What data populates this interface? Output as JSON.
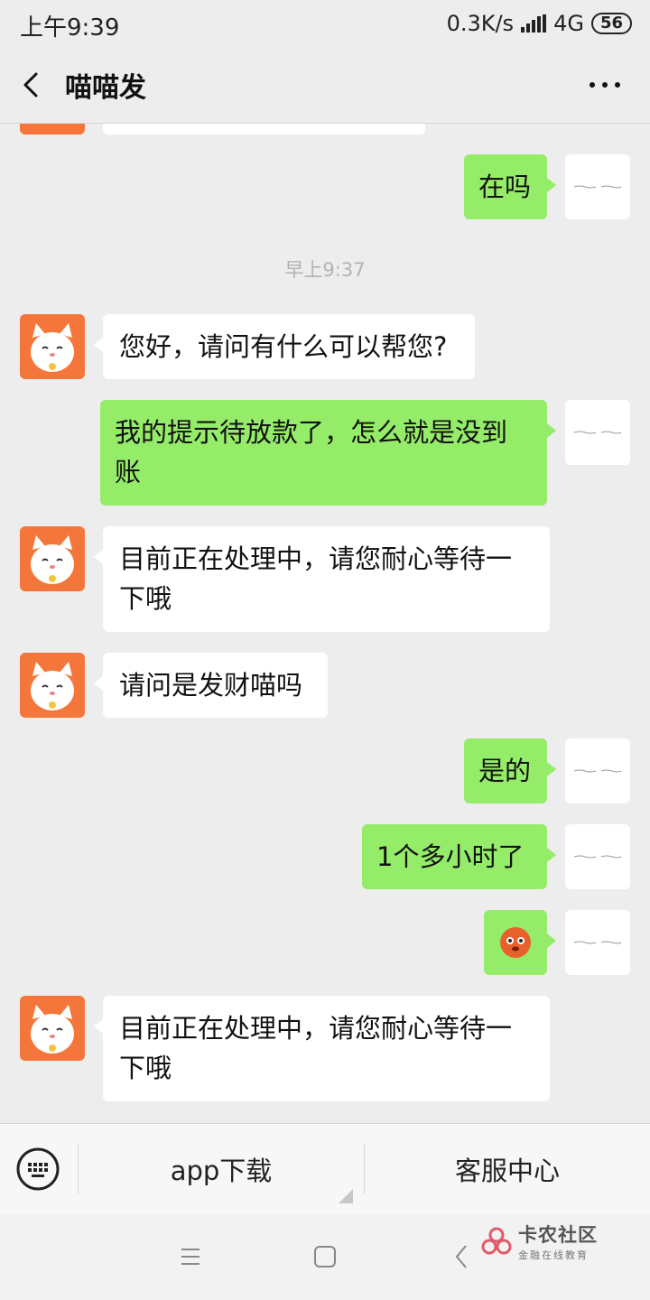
{
  "status_bar": {
    "time": "上午9:39",
    "speed": "0.3K/s",
    "network": "4G",
    "battery": "56"
  },
  "header": {
    "title": "喵喵发"
  },
  "chat": {
    "timestamp": "早上9:37",
    "messages": [
      {
        "side": "right",
        "text": "在吗"
      },
      {
        "side": "left",
        "text": "您好，请问有什么可以帮您?"
      },
      {
        "side": "right",
        "text": "我的提示待放款了，怎么就是没到账"
      },
      {
        "side": "left",
        "text": "目前正在处理中，请您耐心等待一下哦"
      },
      {
        "side": "left",
        "text": "请问是发财喵吗"
      },
      {
        "side": "right",
        "text": "是的"
      },
      {
        "side": "right",
        "text": "1个多小时了"
      },
      {
        "side": "right",
        "emoji": "flushed-face-icon"
      },
      {
        "side": "left",
        "text": "目前正在处理中，请您耐心等待一下哦"
      }
    ]
  },
  "menu": {
    "items": [
      "app下载",
      "客服中心"
    ]
  },
  "watermark": {
    "title": "卡农社区",
    "subtitle": "金融在线教育"
  },
  "colors": {
    "background": "#ededed",
    "self_bubble": "#95ec69",
    "other_bubble": "#ffffff",
    "avatar": "#f5763a"
  }
}
